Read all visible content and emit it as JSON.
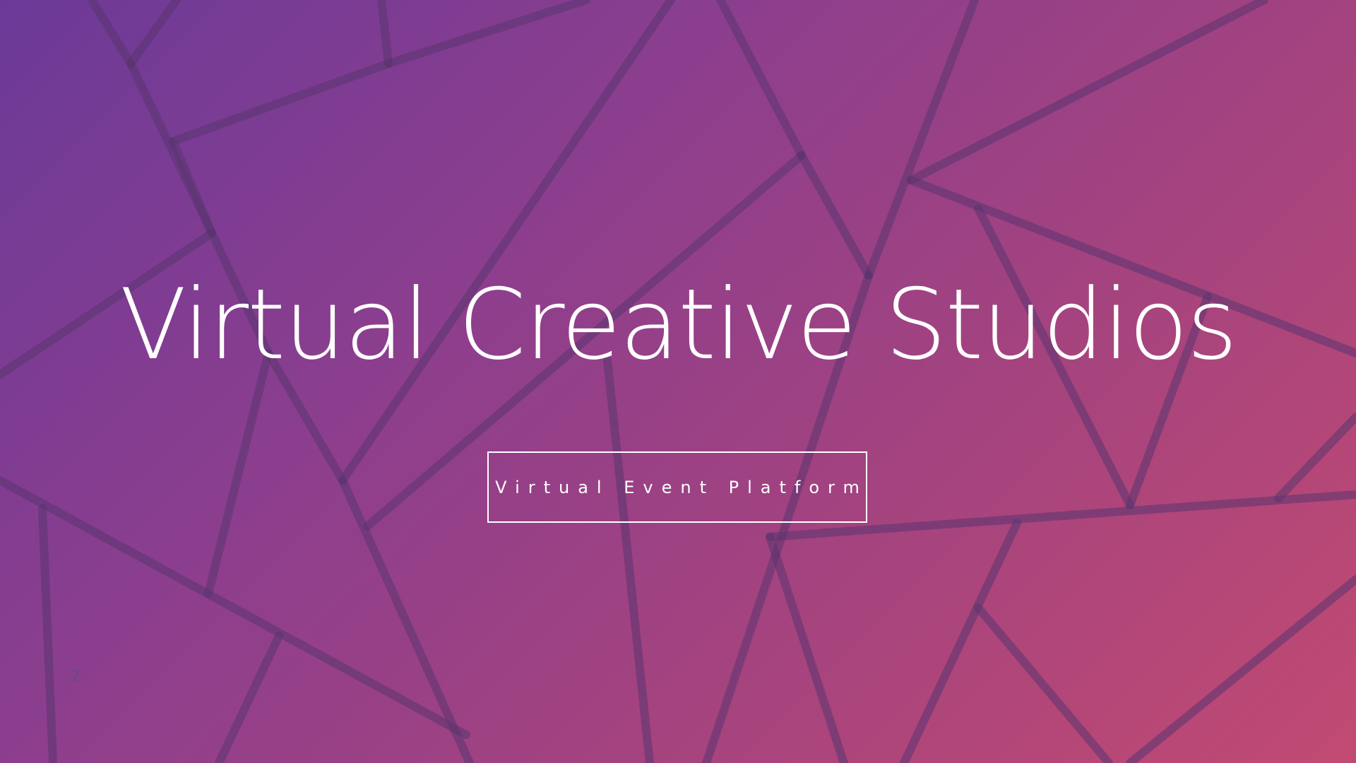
{
  "slide": {
    "title": "Virtual Creative Studios",
    "subtitle": "Virtual Event Platform",
    "page_number": "2"
  },
  "colors": {
    "gradient_start": "#6b3a98",
    "gradient_end": "#c14a72",
    "text": "#ffffff",
    "line_pattern": "#5a3470"
  }
}
